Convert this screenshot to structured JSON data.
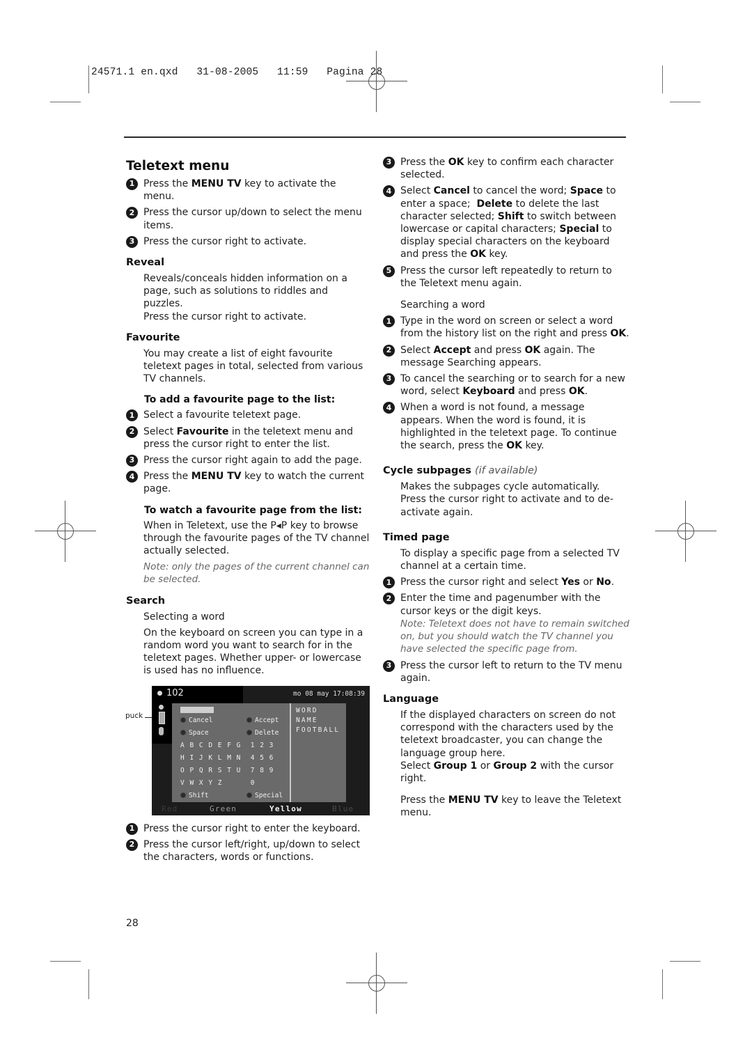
{
  "print_slug": "24571.1 en.qxd   31-08-2005   11:59   Pagina 28",
  "page_number": "28",
  "left_column": {
    "title": "Teletext menu",
    "intro_steps": [
      {
        "n": "1",
        "html": "Press the <b>MENU TV</b> key to activate the menu."
      },
      {
        "n": "2",
        "html": "Press the cursor up/down to select the menu items."
      },
      {
        "n": "3",
        "html": "Press the cursor right to activate."
      }
    ],
    "reveal": {
      "heading": "Reveal",
      "text": "Reveals/conceals hidden information on a page, such as solutions to riddles and puzzles.",
      "text2": "Press the cursor right to activate."
    },
    "favourite": {
      "heading": "Favourite",
      "text": "You may create a list of eight favourite teletext pages in total, selected from various TV channels.",
      "add_heading": "To add a favourite page to the list:",
      "add_steps": [
        {
          "n": "1",
          "html": "Select a favourite teletext page."
        },
        {
          "n": "2",
          "html": "Select <b>Favourite</b> in the teletext menu and press the cursor right to enter the list."
        },
        {
          "n": "3",
          "html": "Press the cursor right again to add the page."
        },
        {
          "n": "4",
          "html": "Press the <b>MENU TV</b> key to watch the current page."
        }
      ],
      "watch_heading": "To watch a favourite page from the list:",
      "watch_text": "When in Teletext, use the P◂P key to browse through the favourite pages of the TV channel actually selected.",
      "note": "Note: only the pages of the current channel can be selected."
    },
    "search": {
      "heading": "Search",
      "subheading": "Selecting a word",
      "text": "On the keyboard on screen you can type in a random word you want to search for in the teletext pages. Whether upper- or lowercase is used has no influence.",
      "steps": [
        {
          "n": "1",
          "html": "Press the cursor right to enter the keyboard."
        },
        {
          "n": "2",
          "html": "Press the cursor left/right, up/down to select the characters, words or functions."
        }
      ]
    }
  },
  "tv_screen": {
    "callout_label": "puck",
    "page": "102",
    "clock": "mo 08 may 17:08:39",
    "functions": {
      "cancel": "Cancel",
      "accept": "Accept",
      "space": "Space",
      "delete": "Delete",
      "shift": "Shift",
      "special": "Special"
    },
    "keyboard_rows": [
      "A B C D E F G  1 2 3",
      "H I J K L M N  4 5 6",
      "O P Q R S T U  7 8 9",
      "V W X Y Z      0"
    ],
    "history": [
      "WORD",
      "NAME",
      "FOOTBALL"
    ],
    "color_keys": [
      {
        "label": "Red",
        "color": "#3c3c3c"
      },
      {
        "label": "Green",
        "color": "#9a9a9a"
      },
      {
        "label": "Yellow",
        "color": "#f2f2f2"
      },
      {
        "label": "Blue",
        "color": "#4a4a4a"
      }
    ]
  },
  "right_column": {
    "search_steps_cont": [
      {
        "n": "3",
        "html": "Press the <b>OK</b> key to confirm each character selected."
      },
      {
        "n": "4",
        "html": "Select <b>Cancel</b> to cancel the word; <b>Space</b> to enter a space;&nbsp; <b>Delete</b> to delete the last character selected; <b>Shift</b> to switch between lowercase or capital characters; <b>Special</b> to display special characters on the keyboard and press the <b>OK</b> key."
      },
      {
        "n": "5",
        "html": "Press the cursor left repeatedly to return to the Teletext menu again."
      }
    ],
    "searching": {
      "subheading": "Searching a word",
      "steps": [
        {
          "n": "1",
          "html": "Type in the word on screen or select a word from the history list on the right and press <b>OK</b>."
        },
        {
          "n": "2",
          "html": "Select <b>Accept</b> and press <b>OK</b> again. The message Searching appears."
        },
        {
          "n": "3",
          "html": "To cancel the searching or to search for a new word, select <b>Keyboard</b> and press <b>OK</b>."
        },
        {
          "n": "4",
          "html": "When a word is not found, a message appears. When the word is found, it is highlighted in the teletext page. To continue the search, press the <b>OK</b> key."
        }
      ]
    },
    "cycle": {
      "heading": "Cycle subpages",
      "aside": "(if available)",
      "text": "Makes the subpages cycle automatically.",
      "text2": "Press the cursor right to activate and to de-activate again."
    },
    "timed": {
      "heading": "Timed page",
      "text": "To display a specific page from a selected TV channel at a certain time.",
      "steps": [
        {
          "n": "1",
          "html": "Press the cursor right and select <b>Yes</b> or <b>No</b>."
        },
        {
          "n": "2",
          "html": "Enter the time and pagenumber with the cursor keys or the digit keys.<span class=\"note\">Note: Teletext does not have to remain switched on, but you should watch the TV channel you have selected the specific page from.</span>"
        },
        {
          "n": "3",
          "html": "Press the cursor left to return to the TV menu again."
        }
      ]
    },
    "language": {
      "heading": "Language",
      "text": "If the displayed characters on screen do not correspond with the characters used by the teletext broadcaster, you can change the language group here.",
      "text2_html": "Select <b>Group 1</b> or <b>Group 2</b> with the cursor right.",
      "closing_html": "Press the <b>MENU TV</b> key to leave the Teletext menu."
    }
  }
}
